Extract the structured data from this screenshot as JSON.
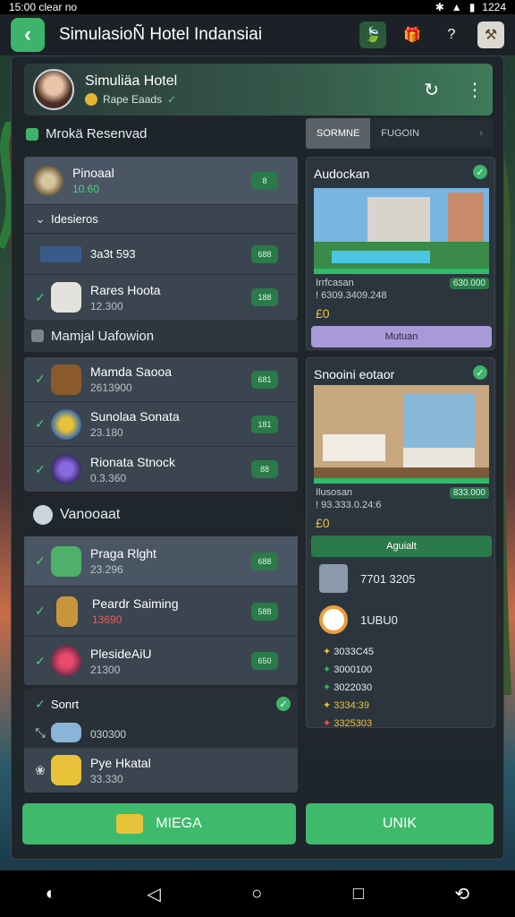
{
  "status": {
    "time": "15:00 clear no",
    "clock": "1224"
  },
  "header": {
    "title": "SimulasioÑ Hotel Indansiai"
  },
  "profile": {
    "name": "Simuliäa Hotel",
    "sub": "Rape Eaads"
  },
  "left": {
    "section1": "Mrokä Resenvad",
    "card1": {
      "title_item": {
        "label": "Pinoaal",
        "value": "10.60",
        "pill": "8"
      },
      "subhead": "Idesieros",
      "rows": [
        {
          "label": "3a3t 593",
          "pill": "688"
        },
        {
          "label": "Rares Hoota",
          "value": "12.300",
          "pill": "188"
        }
      ]
    },
    "section2": "Mamjal Uafowion",
    "card2": {
      "rows": [
        {
          "label": "Mamda Saooa",
          "value": "2613900",
          "pill": "681"
        },
        {
          "label": "Sunolaa Sonata",
          "value": "23.180",
          "pill": "181"
        },
        {
          "label": "Rionata Stnock",
          "value": "0.3.360",
          "pill": "88"
        }
      ]
    },
    "section3": "Vanooaat",
    "card3": {
      "rows": [
        {
          "label": "Praga Rlght",
          "value": "23.296",
          "pill": "688"
        },
        {
          "label": "Peardr Saiming",
          "value": "13690",
          "pill": "588"
        },
        {
          "label": "PlesideAiU",
          "value": "21300",
          "pill": "650"
        }
      ]
    },
    "card4": {
      "head": "Sonrt",
      "value": "030300",
      "item": {
        "label": "Pye Hkatal",
        "value": "33.330"
      }
    }
  },
  "tabs": {
    "active": "SORMNE",
    "second": "FUGOIN",
    "more": "›"
  },
  "right": {
    "card1": {
      "title": "Audockan",
      "price_label": "Irrfcasan",
      "price_value": "! 6309.3409.248",
      "pill": "630.000",
      "price_main": "£0",
      "button": "Mutuan"
    },
    "card2": {
      "title": "Snooini eotaor",
      "price_label": "Ilusosan",
      "price_value": "! 93.333.0.24:6",
      "pill": "833.000",
      "price_main": "£0",
      "button": "Aguialt",
      "stat1": "7701 3205",
      "stat2": "1UBU0",
      "list": [
        "3033C45",
        "3000100",
        "3022030",
        "3334:39",
        "3325303"
      ]
    }
  },
  "bottom": {
    "left_btn": "MIEGA",
    "right_btn": "UNIK"
  },
  "colors": {
    "accent": "#3db46a",
    "panel": "#1e242a",
    "row": "#3a4550"
  }
}
